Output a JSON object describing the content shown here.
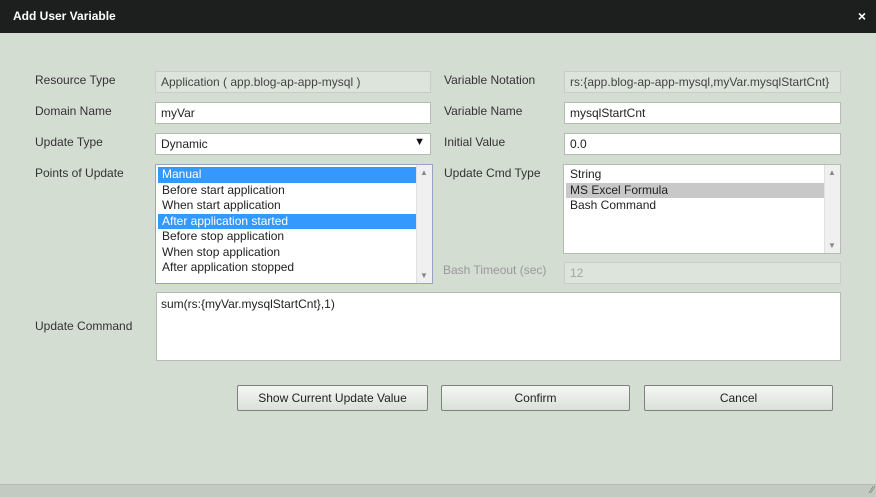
{
  "window": {
    "title": "Add User Variable",
    "close_symbol": "×"
  },
  "form": {
    "resource_type": {
      "label": "Resource Type",
      "value": "Application ( app.blog-ap-app-mysql )"
    },
    "domain_name": {
      "label": "Domain Name",
      "value": "myVar"
    },
    "update_type": {
      "label": "Update Type",
      "value": "Dynamic"
    },
    "points_of_update": {
      "label": "Points of Update",
      "items": [
        {
          "text": "Manual",
          "selected": true
        },
        {
          "text": "Before start application",
          "selected": false
        },
        {
          "text": "When start application",
          "selected": false
        },
        {
          "text": "After application started",
          "selected": true
        },
        {
          "text": "Before stop application",
          "selected": false
        },
        {
          "text": "When stop application",
          "selected": false
        },
        {
          "text": "After application stopped",
          "selected": false
        }
      ]
    },
    "variable_notation": {
      "label": "Variable Notation",
      "value": "rs:{app.blog-ap-app-mysql,myVar.mysqlStartCnt}"
    },
    "variable_name": {
      "label": "Variable Name",
      "value": "mysqlStartCnt"
    },
    "initial_value": {
      "label": "Initial Value",
      "value": "0.0"
    },
    "update_cmd_type": {
      "label": "Update Cmd Type",
      "items": [
        {
          "text": "String",
          "selected": false
        },
        {
          "text": "MS Excel Formula",
          "selected": true
        },
        {
          "text": "Bash Command",
          "selected": false
        }
      ]
    },
    "bash_timeout": {
      "label": "Bash Timeout (sec)",
      "value": "12"
    },
    "update_command": {
      "label": "Update Command",
      "value": "sum(rs:{myVar.mysqlStartCnt},1)"
    }
  },
  "buttons": {
    "show_current": "Show Current Update Value",
    "confirm": "Confirm",
    "cancel": "Cancel"
  }
}
